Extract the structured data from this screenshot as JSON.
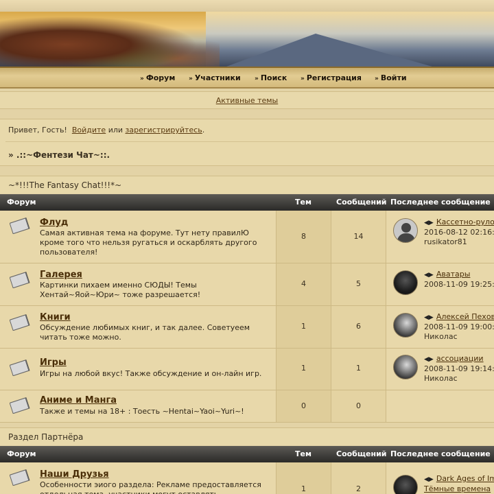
{
  "nav": {
    "items": [
      "Форум",
      "Участники",
      "Поиск",
      "Регистрация",
      "Войти"
    ]
  },
  "active_topics": "Активные темы",
  "welcome": {
    "greeting": "Привет, Гость!",
    "login": "Войдите",
    "or": "или",
    "register": "зарегистрируйтесь",
    "period": ".",
    "breadcrumb": "» .::~Фентези Чат~::."
  },
  "headers": {
    "forum": "Форум",
    "topics": "Тем",
    "posts": "Сообщений",
    "last": "Последнее сообщение"
  },
  "categories": [
    {
      "title": "~*!!!The Fantasy Chat!!!*~",
      "forums": [
        {
          "name": "Флуд",
          "desc": "Самая активная тема на форуме. Тут нету правилЮ кроме того что нельзя ругаться и оскарблять другого пользователя!",
          "topics": "8",
          "posts": "14",
          "last_title": "Кассетно-рулонные жалюзи",
          "last_date": "2016-08-12 02:16:",
          "last_user": "rusikator81",
          "avatar": "default-avatar"
        },
        {
          "name": "Галерея",
          "desc": "Картинки пихаем именно СЮДЫ! Темы Хентай~Яой~Юри~ тоже разрешается!",
          "topics": "4",
          "posts": "5",
          "last_title": "Аватары",
          "last_date": "2008-11-09 19:25:",
          "last_user": "",
          "avatar": "dark-avatar"
        },
        {
          "name": "Книги",
          "desc": "Обсуждение любимых книг, и так далее. Советуеем читать тоже можно.",
          "topics": "1",
          "posts": "6",
          "last_title": "Алексей Пехов",
          "last_date": "2008-11-09 19:00:",
          "last_user": "Николас",
          "avatar": "girl-avatar"
        },
        {
          "name": "Игры",
          "desc": "Игры на любой вкус! Также обсуждение и он-лайн игр.",
          "topics": "1",
          "posts": "1",
          "last_title": "ассоциации",
          "last_date": "2008-11-09 19:14:",
          "last_user": "Николас",
          "avatar": "girl-avatar"
        },
        {
          "name": "Аниме и Манга",
          "desc": "Также и темы на 18+ : Тоесть ~Hentai~Yaoi~Yuri~!",
          "topics": "0",
          "posts": "0",
          "last_title": "",
          "last_date": "",
          "last_user": "",
          "avatar": ""
        }
      ]
    },
    {
      "title": "Раздел Партнёра",
      "forums": [
        {
          "name": "Наши Друзья",
          "desc": "Особенности эиого раздела: Рекламе предоставляется отдельная тема, участники могут оставлять",
          "topics": "1",
          "posts": "2",
          "last_title": "Dark Ages of Im",
          "last_date": "Тёмные времена",
          "last_user": "",
          "avatar": "dark-avatar"
        }
      ]
    }
  ]
}
